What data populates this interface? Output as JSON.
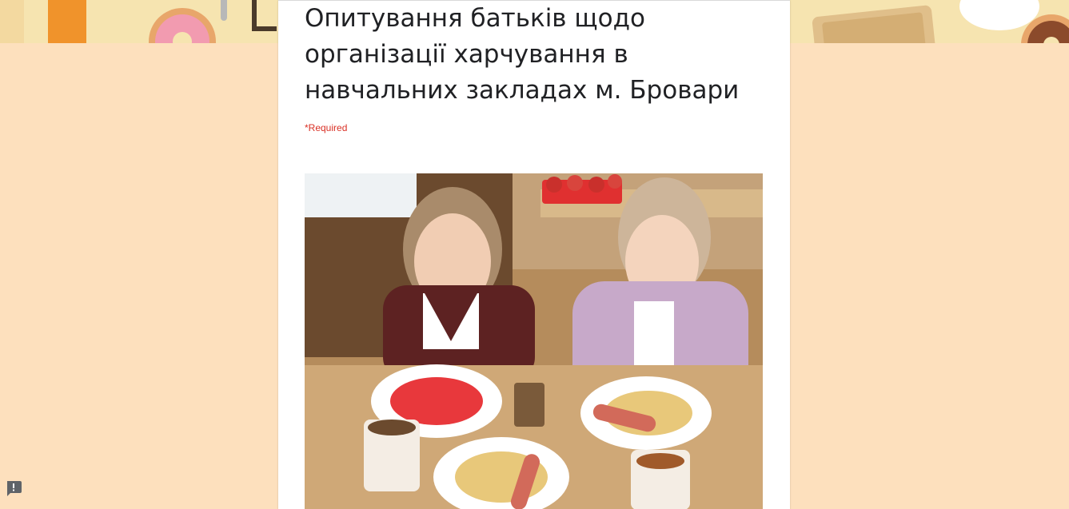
{
  "form": {
    "title": "Опитування батьків щодо організації харчування в навчальних закладах м. Бровари",
    "required_note": "*Required"
  },
  "header_image": {
    "icon": "food-pattern-banner"
  },
  "photo": {
    "icon": "school-lunch-photo"
  },
  "report": {
    "icon": "report-problem-icon"
  },
  "colors": {
    "page_background": "#fde0bd",
    "card_background": "#ffffff",
    "required": "#d93025",
    "title": "#202124"
  }
}
